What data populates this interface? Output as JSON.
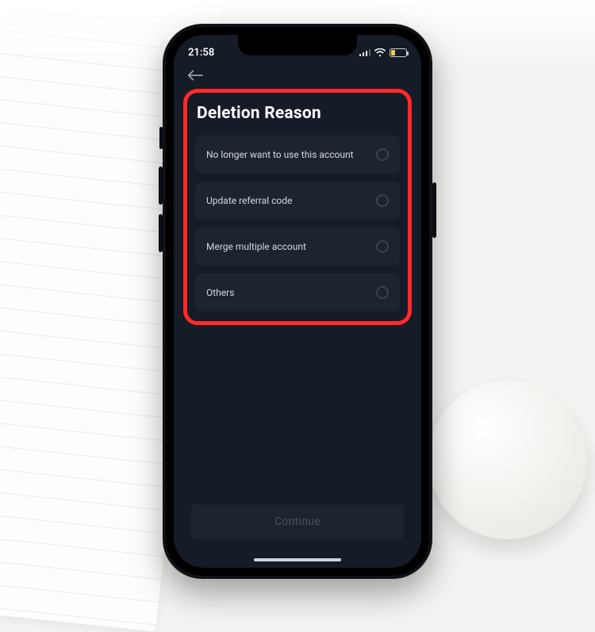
{
  "statusBar": {
    "time": "21:58"
  },
  "page": {
    "title": "Deletion Reason"
  },
  "options": [
    {
      "label": "No longer want to use this account"
    },
    {
      "label": "Update referral code"
    },
    {
      "label": "Merge multiple account"
    },
    {
      "label": "Others"
    }
  ],
  "actions": {
    "continue": "Continue"
  }
}
